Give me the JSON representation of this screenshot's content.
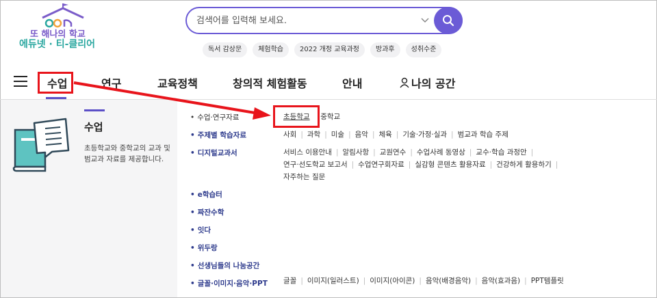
{
  "logo": {
    "line1": "또 해나의 학교",
    "line2": "에듀넷 · 티-클리어"
  },
  "search": {
    "placeholder": "검색어를 입력해 보세요."
  },
  "tags": [
    "독서 감상문",
    "체험학습",
    "2022 개정 교육과정",
    "방과후",
    "성취수준"
  ],
  "nav": {
    "items": [
      "수업",
      "연구",
      "교육정책",
      "창의적 체험활동",
      "안내",
      "나의 공간"
    ]
  },
  "section": {
    "title": "수업",
    "description": "초등학교와 중학교의 교과 및 범교과 자료를 제공합니다."
  },
  "menu": {
    "categories": [
      {
        "label": "수업·연구자료",
        "subs": [
          "초등학교",
          "중학교"
        ]
      },
      {
        "label": "주제별 학습자료",
        "subs": [
          "사회",
          "과학",
          "미술",
          "음악",
          "체육",
          "기술·가정·실과",
          "범교과 학습 주제"
        ]
      },
      {
        "label": "디지털교과서",
        "subs": [
          "서비스 이용안내",
          "알림사항",
          "교원연수",
          "수업사례 동영상",
          "교수·학습 과정안",
          "연구·선도학교 보고서",
          "수업연구회자료",
          "실감형 콘텐츠 활용자료",
          "건강하게 활용하기",
          "자주하는 질문"
        ]
      },
      {
        "label": "e학습터",
        "subs": []
      },
      {
        "label": "짜잔수학",
        "subs": []
      },
      {
        "label": "잇다",
        "subs": []
      },
      {
        "label": "위두랑",
        "subs": []
      },
      {
        "label": "선생님들의 나눔공간",
        "subs": []
      },
      {
        "label": "글꼴·이미지·음악·PPT",
        "subs": [
          "글꼴",
          "이미지(일러스트)",
          "이미지(아이콘)",
          "음악(배경음악)",
          "음악(효과음)",
          "PPT템플릿"
        ]
      }
    ]
  },
  "colors": {
    "accent": "#6b5bd6",
    "highlight": "#e8141b",
    "category": "#2d3a8c"
  }
}
